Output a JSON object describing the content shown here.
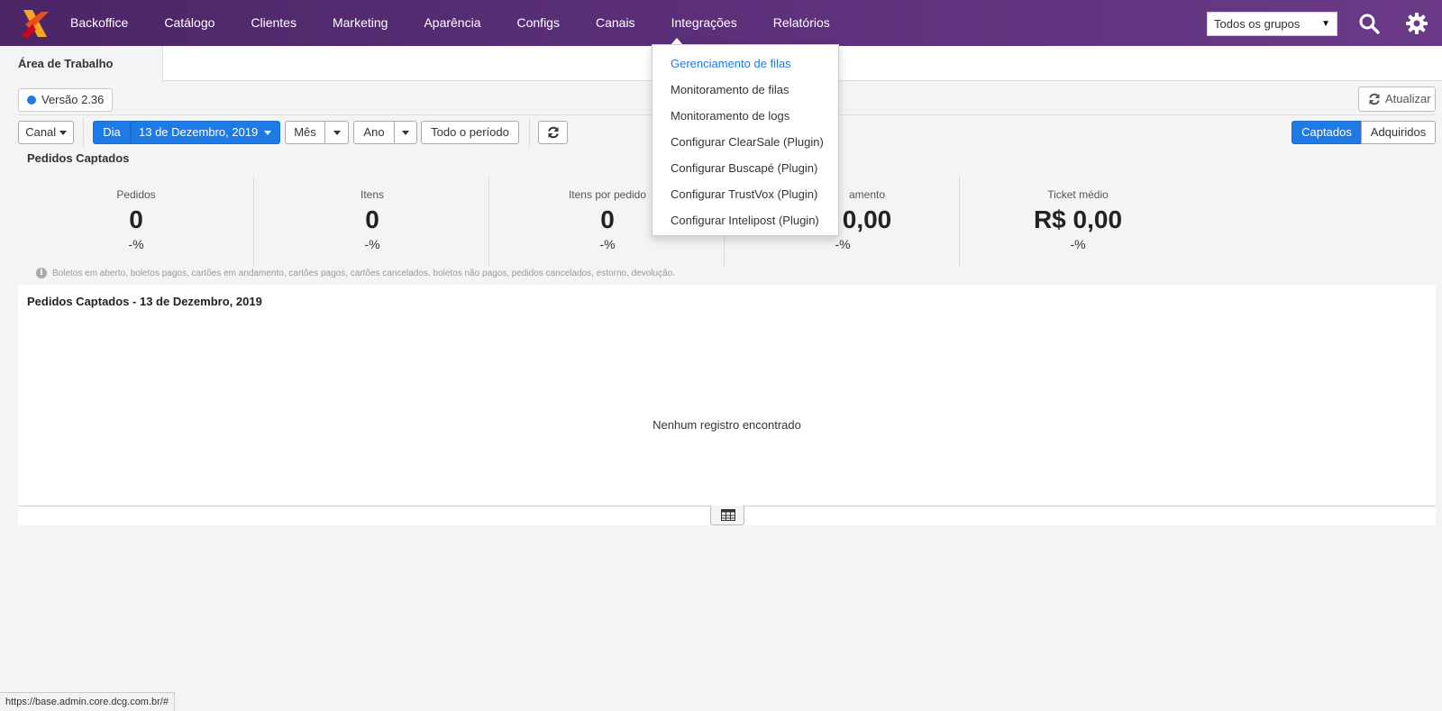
{
  "nav": {
    "items": [
      "Backoffice",
      "Catálogo",
      "Clientes",
      "Marketing",
      "Aparência",
      "Configs",
      "Canais",
      "Integrações",
      "Relatórios"
    ],
    "group_select": "Todos os grupos"
  },
  "tabs": {
    "active": "Área de Trabalho"
  },
  "version": "Versão 2.36",
  "refresh_label": "Atualizar",
  "filters": {
    "canal": "Canal",
    "dia": "Dia",
    "date": "13 de Dezembro, 2019",
    "mes": "Mês",
    "ano": "Ano",
    "todo": "Todo o período",
    "captados": "Captados",
    "adquiridos": "Adquiridos"
  },
  "section_title": "Pedidos Captados",
  "stats": [
    {
      "label": "Pedidos",
      "value": "0",
      "pct": "-%"
    },
    {
      "label": "Itens",
      "value": "0",
      "pct": "-%"
    },
    {
      "label": "Itens por pedido",
      "value": "0",
      "pct": "-%"
    },
    {
      "label": "amento",
      "value": "0,00",
      "pct": "-%"
    },
    {
      "label": "Ticket médio",
      "value": "R$ 0,00",
      "pct": "-%"
    }
  ],
  "note": "Boletos em aberto, boletos pagos, cartões em andamento, cartões pagos, cartões cancelados, boletos não pagos, pedidos cancelados, estorno, devolução.",
  "panel": {
    "title": "Pedidos Captados - 13 de Dezembro, 2019",
    "empty": "Nenhum registro encontrado"
  },
  "dropdown": {
    "items": [
      "Gerenciamento de filas",
      "Monitoramento de filas",
      "Monitoramento de logs",
      "Configurar ClearSale (Plugin)",
      "Configurar Buscapé (Plugin)",
      "Configurar TrustVox (Plugin)",
      "Configurar Intelipost (Plugin)"
    ]
  },
  "status_url": "https://base.admin.core.dcg.com.br/#",
  "colors": {
    "accent": "#1e7be6",
    "nav_bg": "#5a2f78"
  }
}
